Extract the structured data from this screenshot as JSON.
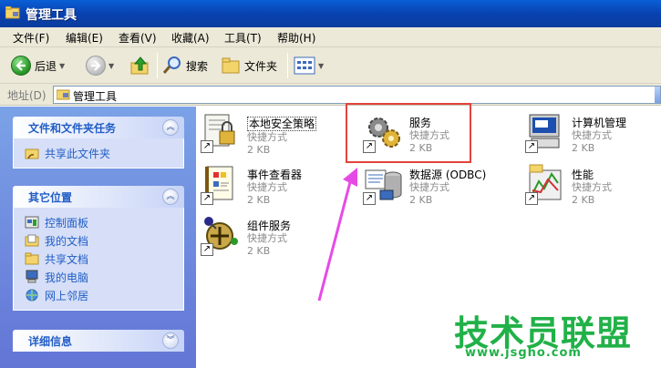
{
  "window": {
    "title": "管理工具"
  },
  "menu": [
    "文件(F)",
    "编辑(E)",
    "查看(V)",
    "收藏(A)",
    "工具(T)",
    "帮助(H)"
  ],
  "toolbar": {
    "back": "后退",
    "search": "搜索",
    "folders": "文件夹"
  },
  "address": {
    "label": "地址(D)",
    "value": "管理工具"
  },
  "tasks": {
    "file_tasks": {
      "title": "文件和文件夹任务",
      "items": [
        "共享此文件夹"
      ]
    },
    "other_places": {
      "title": "其它位置",
      "items": [
        "控制面板",
        "我的文档",
        "共享文档",
        "我的电脑",
        "网上邻居"
      ]
    },
    "details": {
      "title": "详细信息"
    }
  },
  "files": [
    {
      "name": "本地安全策略",
      "type": "快捷方式",
      "size": "2 KB",
      "icon": "security-policy-icon"
    },
    {
      "name": "服务",
      "type": "快捷方式",
      "size": "2 KB",
      "icon": "services-gears-icon"
    },
    {
      "name": "计算机管理",
      "type": "快捷方式",
      "size": "2 KB",
      "icon": "computer-management-icon"
    },
    {
      "name": "事件查看器",
      "type": "快捷方式",
      "size": "2 KB",
      "icon": "event-viewer-icon"
    },
    {
      "name": "数据源 (ODBC)",
      "type": "快捷方式",
      "size": "2 KB",
      "icon": "odbc-datasource-icon"
    },
    {
      "name": "性能",
      "type": "快捷方式",
      "size": "2 KB",
      "icon": "performance-icon"
    },
    {
      "name": "组件服务",
      "type": "快捷方式",
      "size": "2 KB",
      "icon": "component-services-icon"
    }
  ],
  "watermark": {
    "brand": "技术员联盟",
    "url": "www.jsgho.com"
  },
  "colors": {
    "titlebar": "#0842b0",
    "task_pane": "#6f8be0",
    "highlight_box": "#e2443d",
    "annotation_arrow": "#e64ae6",
    "watermark": "#21b148"
  }
}
